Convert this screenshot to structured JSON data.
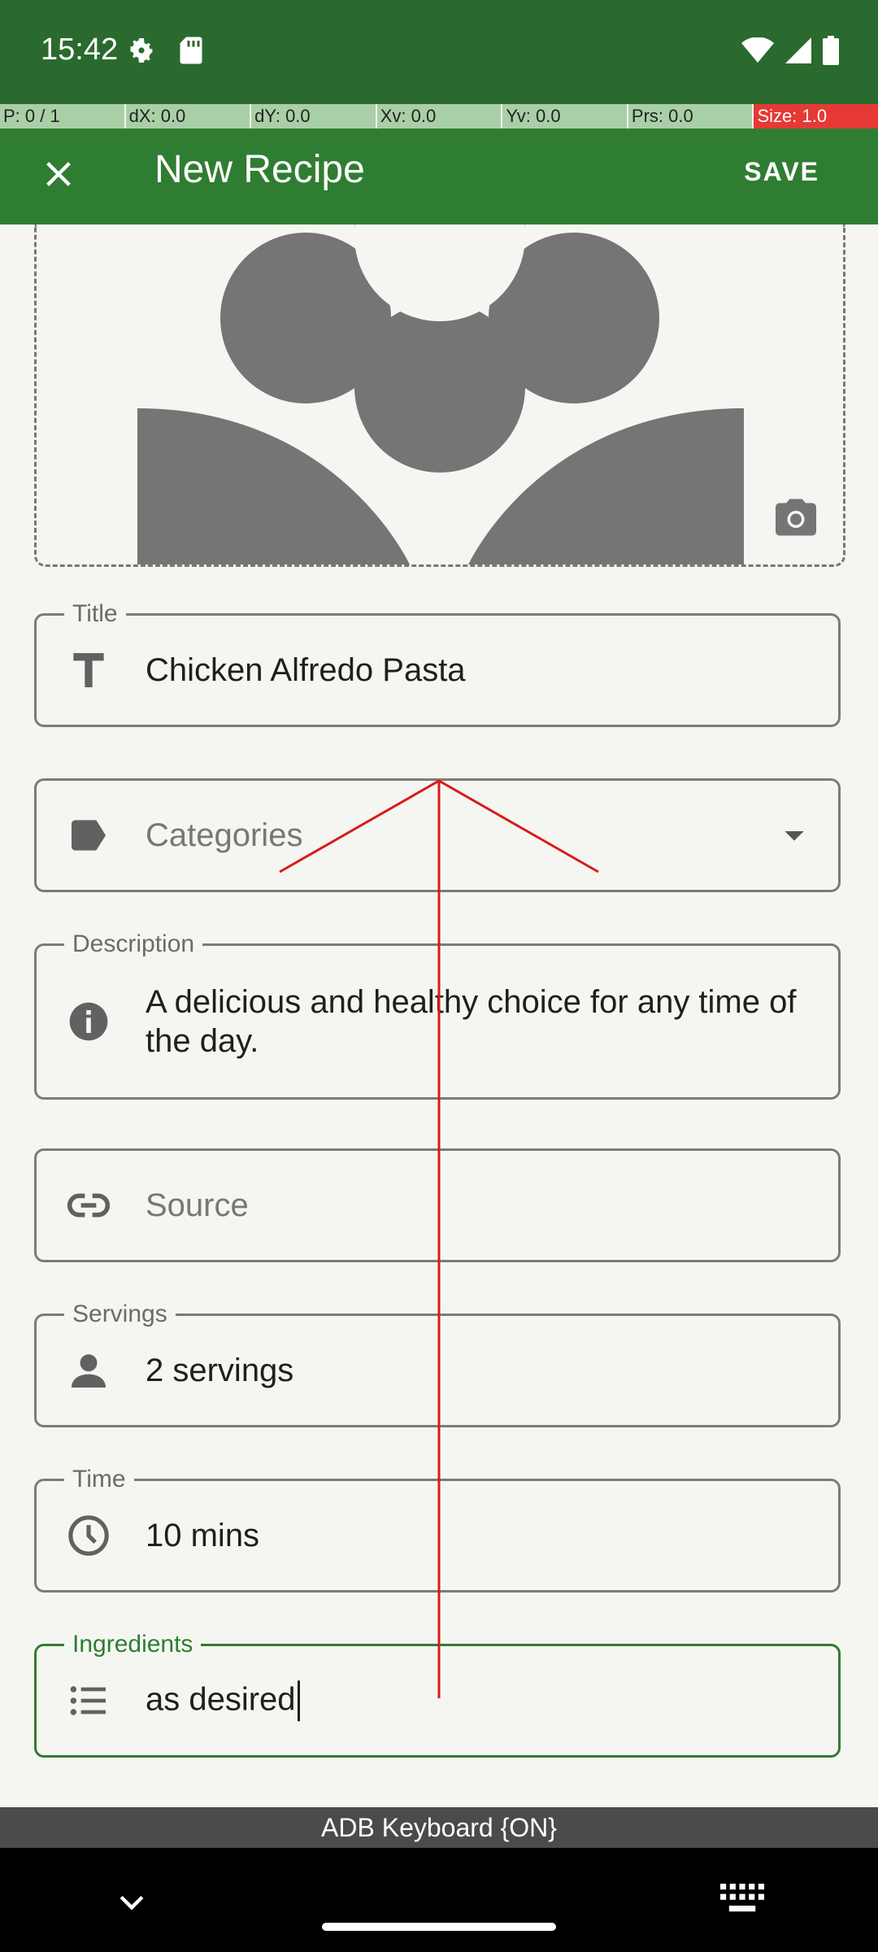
{
  "status_bar": {
    "time": "15:42"
  },
  "pointer_bar": {
    "p": "P: 0 / 1",
    "dx": "dX: 0.0",
    "dy": "dY: 0.0",
    "xv": "Xv: 0.0",
    "yv": "Yv: 0.0",
    "prs": "Prs: 0.0",
    "size": "Size: 1.0"
  },
  "app_bar": {
    "title": "New Recipe",
    "save_label": "SAVE"
  },
  "form": {
    "title": {
      "label": "Title",
      "value": "Chicken Alfredo Pasta"
    },
    "categories": {
      "placeholder": "Categories"
    },
    "description": {
      "label": "Description",
      "value": "A delicious and healthy choice for any time of the day."
    },
    "source": {
      "placeholder": "Source"
    },
    "servings": {
      "label": "Servings",
      "value": "2 servings"
    },
    "time": {
      "label": "Time",
      "value": "10 mins"
    },
    "ingredients": {
      "label": "Ingredients",
      "value": "as desired"
    }
  },
  "keyboard": {
    "label": "ADB Keyboard {ON}"
  },
  "colors": {
    "primary": "#2f7d32",
    "status": "#2a6a2e",
    "gesture": "#d81b1b"
  }
}
